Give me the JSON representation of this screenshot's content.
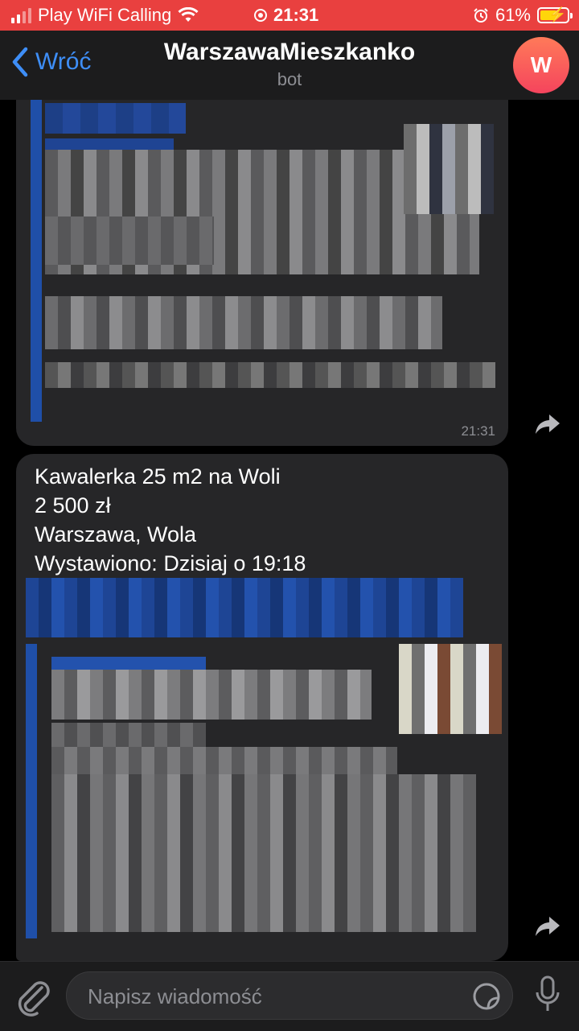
{
  "status_bar": {
    "carrier": "Play WiFi Calling",
    "time": "21:31",
    "battery_percent": "61%",
    "battery_level": 0.61,
    "bg_color": "#e9403f"
  },
  "header": {
    "back_label": "Wróć",
    "title": "WarszawaMieszkanko",
    "subtitle": "bot",
    "avatar_letter": "W",
    "accent_color": "#3e8ef7"
  },
  "messages": [
    {
      "time": "21:31",
      "lines": []
    },
    {
      "lines": [
        "Kawalerka 25 m2 na Woli",
        "2 500 zł",
        "Warszawa, Wola",
        "Wystawiono: Dzisiaj o 19:18"
      ]
    }
  ],
  "composer": {
    "placeholder": "Napisz wiadomość"
  },
  "icons": {
    "back": "chevron-left-icon",
    "forward": "share-arrow-icon",
    "attach": "paperclip-icon",
    "sticker": "sticker-icon",
    "mic": "microphone-icon"
  }
}
